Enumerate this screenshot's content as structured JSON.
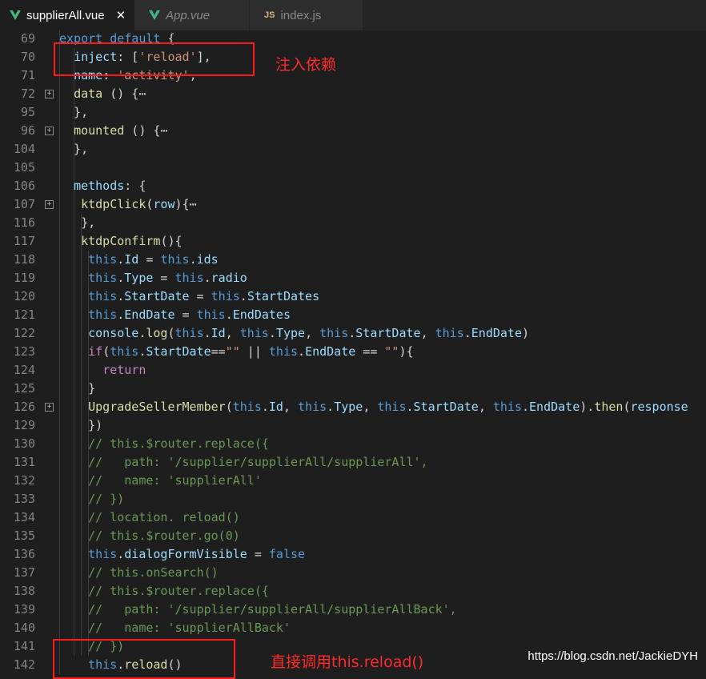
{
  "tabs": [
    {
      "label": "supplierAll.vue",
      "icon": "vue-icon",
      "active": true,
      "italic": false
    },
    {
      "label": "App.vue",
      "icon": "vue-icon",
      "active": false,
      "italic": true
    },
    {
      "label": "index.js",
      "icon": "js-icon",
      "active": false,
      "italic": false
    }
  ],
  "tab_close_glyph": "✕",
  "js_badge": "JS",
  "code_lines": [
    {
      "n": "69",
      "tokens": [
        [
          "k",
          "export"
        ],
        [
          "d",
          " "
        ],
        [
          "k",
          "default"
        ],
        [
          "d",
          " {"
        ]
      ]
    },
    {
      "n": "70",
      "tokens": [
        [
          "d",
          "  "
        ],
        [
          "p",
          "inject"
        ],
        [
          "d",
          ": ["
        ],
        [
          "s",
          "'reload'"
        ],
        [
          "d",
          "],"
        ]
      ]
    },
    {
      "n": "71",
      "tokens": [
        [
          "d",
          "  "
        ],
        [
          "p",
          "name"
        ],
        [
          "d",
          ": "
        ],
        [
          "s",
          "'activity'"
        ],
        [
          "d",
          ","
        ]
      ]
    },
    {
      "n": "72",
      "fold": true,
      "tokens": [
        [
          "d",
          "  "
        ],
        [
          "f",
          "data"
        ],
        [
          "d",
          " () {"
        ],
        [
          "d",
          "⋯"
        ]
      ]
    },
    {
      "n": "95",
      "tokens": [
        [
          "d",
          "  },"
        ]
      ]
    },
    {
      "n": "96",
      "fold": true,
      "tokens": [
        [
          "d",
          "  "
        ],
        [
          "f",
          "mounted"
        ],
        [
          "d",
          " () {"
        ],
        [
          "d",
          "⋯"
        ]
      ]
    },
    {
      "n": "104",
      "tokens": [
        [
          "d",
          "  },"
        ]
      ]
    },
    {
      "n": "105",
      "tokens": []
    },
    {
      "n": "106",
      "tokens": [
        [
          "d",
          "  "
        ],
        [
          "p",
          "methods"
        ],
        [
          "d",
          ": {"
        ]
      ]
    },
    {
      "n": "107",
      "fold": true,
      "tokens": [
        [
          "d",
          "   "
        ],
        [
          "f",
          "ktdpClick"
        ],
        [
          "d",
          "("
        ],
        [
          "p",
          "row"
        ],
        [
          "d",
          "){"
        ],
        [
          "d",
          "⋯"
        ]
      ]
    },
    {
      "n": "116",
      "tokens": [
        [
          "d",
          "   },"
        ]
      ]
    },
    {
      "n": "117",
      "tokens": [
        [
          "d",
          "   "
        ],
        [
          "f",
          "ktdpConfirm"
        ],
        [
          "d",
          "(){"
        ]
      ]
    },
    {
      "n": "118",
      "tokens": [
        [
          "d",
          "    "
        ],
        [
          "k",
          "this"
        ],
        [
          "d",
          "."
        ],
        [
          "p",
          "Id"
        ],
        [
          "d",
          " = "
        ],
        [
          "k",
          "this"
        ],
        [
          "d",
          "."
        ],
        [
          "p",
          "ids"
        ]
      ]
    },
    {
      "n": "119",
      "tokens": [
        [
          "d",
          "    "
        ],
        [
          "k",
          "this"
        ],
        [
          "d",
          "."
        ],
        [
          "p",
          "Type"
        ],
        [
          "d",
          " = "
        ],
        [
          "k",
          "this"
        ],
        [
          "d",
          "."
        ],
        [
          "p",
          "radio"
        ]
      ]
    },
    {
      "n": "120",
      "tokens": [
        [
          "d",
          "    "
        ],
        [
          "k",
          "this"
        ],
        [
          "d",
          "."
        ],
        [
          "p",
          "StartDate"
        ],
        [
          "d",
          " = "
        ],
        [
          "k",
          "this"
        ],
        [
          "d",
          "."
        ],
        [
          "p",
          "StartDates"
        ]
      ]
    },
    {
      "n": "121",
      "tokens": [
        [
          "d",
          "    "
        ],
        [
          "k",
          "this"
        ],
        [
          "d",
          "."
        ],
        [
          "p",
          "EndDate"
        ],
        [
          "d",
          " = "
        ],
        [
          "k",
          "this"
        ],
        [
          "d",
          "."
        ],
        [
          "p",
          "EndDates"
        ]
      ]
    },
    {
      "n": "122",
      "tokens": [
        [
          "d",
          "    "
        ],
        [
          "p",
          "console"
        ],
        [
          "d",
          "."
        ],
        [
          "f",
          "log"
        ],
        [
          "d",
          "("
        ],
        [
          "k",
          "this"
        ],
        [
          "d",
          "."
        ],
        [
          "p",
          "Id"
        ],
        [
          "d",
          ", "
        ],
        [
          "k",
          "this"
        ],
        [
          "d",
          "."
        ],
        [
          "p",
          "Type"
        ],
        [
          "d",
          ", "
        ],
        [
          "k",
          "this"
        ],
        [
          "d",
          "."
        ],
        [
          "p",
          "StartDate"
        ],
        [
          "d",
          ", "
        ],
        [
          "k",
          "this"
        ],
        [
          "d",
          "."
        ],
        [
          "p",
          "EndDate"
        ],
        [
          "d",
          ")"
        ]
      ]
    },
    {
      "n": "123",
      "tokens": [
        [
          "d",
          "    "
        ],
        [
          "c",
          "if"
        ],
        [
          "d",
          "("
        ],
        [
          "k",
          "this"
        ],
        [
          "d",
          "."
        ],
        [
          "p",
          "StartDate"
        ],
        [
          "d",
          "=="
        ],
        [
          "s",
          "\"\""
        ],
        [
          "d",
          " || "
        ],
        [
          "k",
          "this"
        ],
        [
          "d",
          "."
        ],
        [
          "p",
          "EndDate"
        ],
        [
          "d",
          " == "
        ],
        [
          "s",
          "\"\""
        ],
        [
          "d",
          "){"
        ]
      ]
    },
    {
      "n": "124",
      "tokens": [
        [
          "d",
          "      "
        ],
        [
          "c",
          "return"
        ]
      ]
    },
    {
      "n": "125",
      "tokens": [
        [
          "d",
          "    }"
        ]
      ]
    },
    {
      "n": "126",
      "fold": true,
      "tokens": [
        [
          "d",
          "    "
        ],
        [
          "f",
          "UpgradeSellerMember"
        ],
        [
          "d",
          "("
        ],
        [
          "k",
          "this"
        ],
        [
          "d",
          "."
        ],
        [
          "p",
          "Id"
        ],
        [
          "d",
          ", "
        ],
        [
          "k",
          "this"
        ],
        [
          "d",
          "."
        ],
        [
          "p",
          "Type"
        ],
        [
          "d",
          ", "
        ],
        [
          "k",
          "this"
        ],
        [
          "d",
          "."
        ],
        [
          "p",
          "StartDate"
        ],
        [
          "d",
          ", "
        ],
        [
          "k",
          "this"
        ],
        [
          "d",
          "."
        ],
        [
          "p",
          "EndDate"
        ],
        [
          "d",
          ")."
        ],
        [
          "f",
          "then"
        ],
        [
          "d",
          "("
        ],
        [
          "p",
          "response"
        ]
      ]
    },
    {
      "n": "129",
      "tokens": [
        [
          "d",
          "    })"
        ]
      ]
    },
    {
      "n": "130",
      "tokens": [
        [
          "d",
          "    "
        ],
        [
          "m",
          "// this.$router.replace({"
        ]
      ]
    },
    {
      "n": "131",
      "tokens": [
        [
          "d",
          "    "
        ],
        [
          "m",
          "//   path: '/supplier/supplierAll/supplierAll',"
        ]
      ]
    },
    {
      "n": "132",
      "tokens": [
        [
          "d",
          "    "
        ],
        [
          "m",
          "//   name: 'supplierAll'"
        ]
      ]
    },
    {
      "n": "133",
      "tokens": [
        [
          "d",
          "    "
        ],
        [
          "m",
          "// })"
        ]
      ]
    },
    {
      "n": "134",
      "tokens": [
        [
          "d",
          "    "
        ],
        [
          "m",
          "// location. reload()"
        ]
      ]
    },
    {
      "n": "135",
      "tokens": [
        [
          "d",
          "    "
        ],
        [
          "m",
          "// this.$router.go(0)"
        ]
      ]
    },
    {
      "n": "136",
      "tokens": [
        [
          "d",
          "    "
        ],
        [
          "k",
          "this"
        ],
        [
          "d",
          "."
        ],
        [
          "p",
          "dialogFormVisible"
        ],
        [
          "d",
          " = "
        ],
        [
          "k",
          "false"
        ]
      ]
    },
    {
      "n": "137",
      "tokens": [
        [
          "d",
          "    "
        ],
        [
          "m",
          "// this.onSearch()"
        ]
      ]
    },
    {
      "n": "138",
      "tokens": [
        [
          "d",
          "    "
        ],
        [
          "m",
          "// this.$router.replace({"
        ]
      ]
    },
    {
      "n": "139",
      "tokens": [
        [
          "d",
          "    "
        ],
        [
          "m",
          "//   path: '/supplier/supplierAll/supplierAllBack',"
        ]
      ]
    },
    {
      "n": "140",
      "tokens": [
        [
          "d",
          "    "
        ],
        [
          "m",
          "//   name: 'supplierAllBack'"
        ]
      ]
    },
    {
      "n": "141",
      "tokens": [
        [
          "d",
          "    "
        ],
        [
          "m",
          "// })"
        ]
      ]
    },
    {
      "n": "142",
      "tokens": [
        [
          "d",
          "    "
        ],
        [
          "k",
          "this"
        ],
        [
          "d",
          "."
        ],
        [
          "f",
          "reload"
        ],
        [
          "d",
          "()"
        ]
      ]
    }
  ],
  "annotations": {
    "inject_note": "注入依赖",
    "reload_note": "直接调用this.reload()"
  },
  "watermark": "https://blog.csdn.net/JackieDYH",
  "colors": {
    "annotation_red": "#ff1c1c",
    "editor_bg": "#1e1e1e",
    "tab_bar_bg": "#252526",
    "keyword": "#569cd6",
    "string": "#ce9178",
    "property": "#9cdcfe",
    "function": "#dcdcaa",
    "comment": "#6a9955",
    "control": "#c586c0"
  }
}
